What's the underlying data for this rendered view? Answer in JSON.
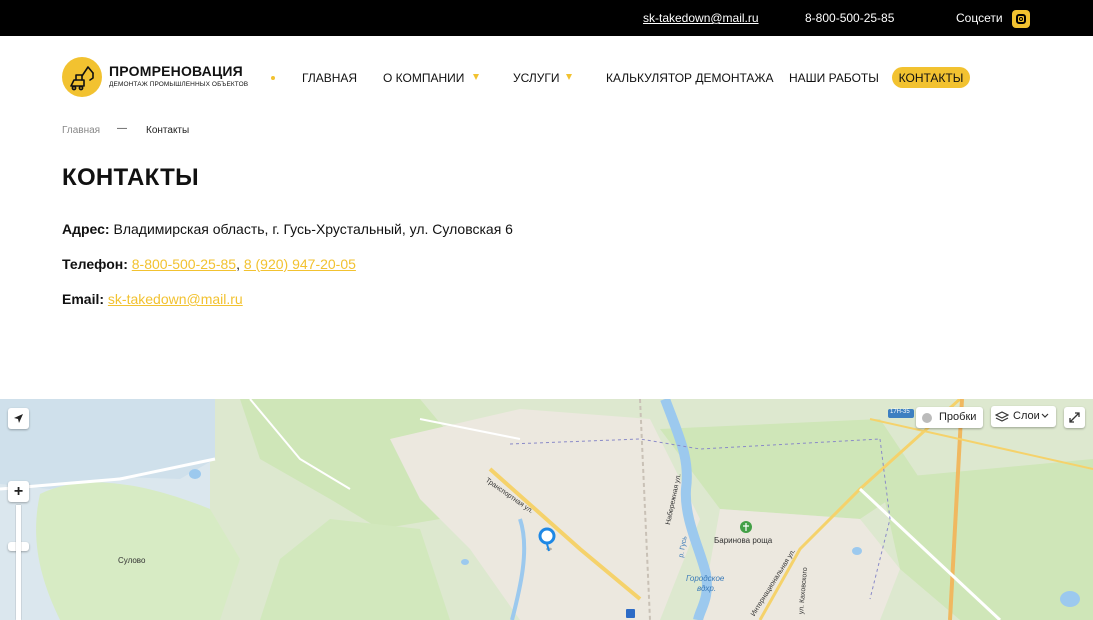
{
  "topbar": {
    "email": "sk-takedown@mail.ru",
    "phone": "8-800-500-25-85",
    "social_label": "Соцсети",
    "social_icon": "instagram-icon"
  },
  "logo": {
    "title": "ПРОМРЕНОВАЦИЯ",
    "subtitle": "ДЕМОНТАЖ ПРОМЫШЛЕННЫХ ОБЪЕКТОВ",
    "icon": "excavator-icon"
  },
  "nav": {
    "home": "ГЛАВНАЯ",
    "about": "О КОМПАНИИ",
    "services": "УСЛУГИ",
    "calculator": "КАЛЬКУЛЯТОР ДЕМОНТАЖА",
    "works": "НАШИ РАБОТЫ",
    "contacts": "КОНТАКТЫ"
  },
  "breadcrumb": {
    "home": "Главная",
    "separator": "—",
    "current": "Контакты"
  },
  "page": {
    "title": "КОНТАКТЫ",
    "address_label": "Адрес:",
    "address_value": "Владимирская область, г. Гусь-Хрустальный, ул. Суловская 6",
    "phone_label": "Телефон:",
    "phone_1": "8-800-500-25-85",
    "phone_sep": ",",
    "phone_2": "8 (920) 947-20-05",
    "email_label": "Email:",
    "email_value": "sk-takedown@mail.ru"
  },
  "map": {
    "traffic_label": "Пробки",
    "layers_label": "Слои",
    "zoom_plus": "+",
    "road_badge": "17Н-35",
    "labels": {
      "sulovo": "Сулово",
      "transport_st": "Транспортная ул.",
      "naberezhnaya": "Набережная ул.",
      "river": "р. Гусь",
      "barinova": "Баринова роща",
      "reservoir_1": "Городское",
      "reservoir_2": "вдхр.",
      "international": "Интернациональная ул.",
      "kakhovskogo": "ул. Каховского"
    }
  },
  "colors": {
    "accent": "#f2c230",
    "topbar_bg": "#000000",
    "map_pin": "#1e88e5"
  }
}
